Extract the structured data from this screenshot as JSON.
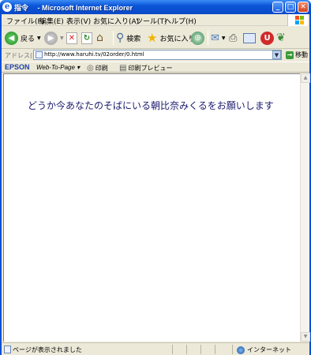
{
  "window": {
    "title": "指令　 - Microsoft Internet Explorer",
    "minimize_glyph": "_",
    "maximize_glyph": "□",
    "close_glyph": "✕"
  },
  "menu": [
    "ファイル(F)",
    "編集(E)",
    "表示(V)",
    "お気に入り(A)",
    "ツール(T)",
    "ヘルプ(H)"
  ],
  "toolbar": {
    "back_label": "戻る",
    "search_label": "検索",
    "favorites_label": "お気に入り"
  },
  "address": {
    "label": "アドレス(D)",
    "url": "http://www.haruhi.tv/02order/0.html",
    "go_label": "移動"
  },
  "epson": {
    "logo": "EPSON",
    "web_to_page": "Web-To-Page ▾",
    "print_label": "印刷",
    "preview_label": "印刷プレビュー"
  },
  "page": {
    "message": "どうか今あなたのそばにいる朝比奈みくるをお願いします"
  },
  "status": {
    "text": "ページが表示されました",
    "zone": "インターネット"
  },
  "colors": {
    "titlebar": "#0b55d8",
    "message_text": "#1b1b6e",
    "chrome": "#ece9d8"
  }
}
